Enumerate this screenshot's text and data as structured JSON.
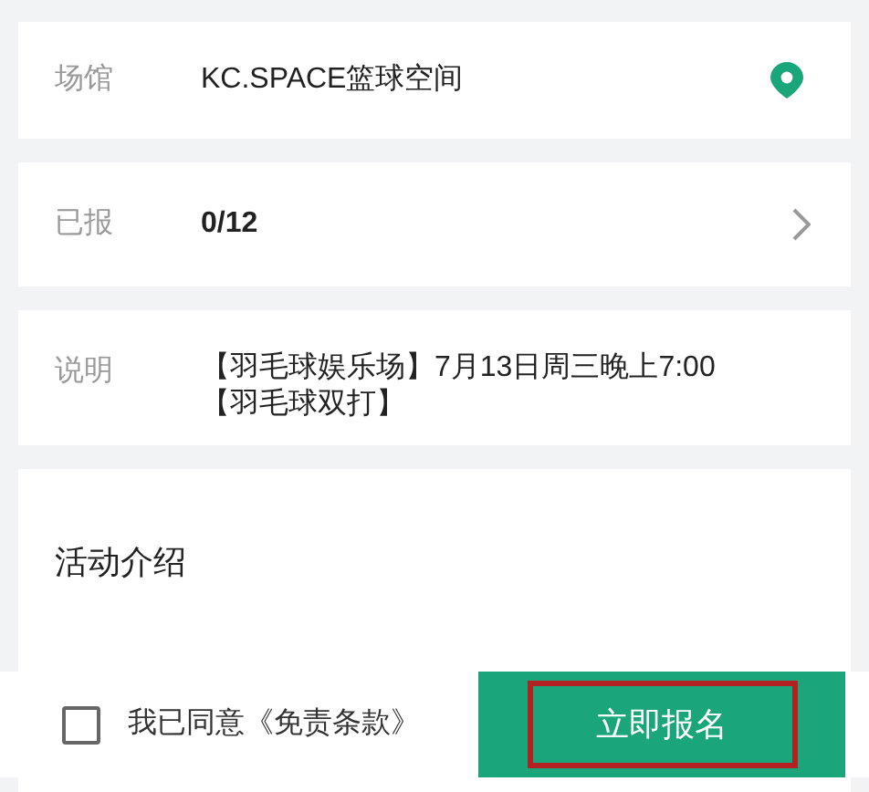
{
  "venue": {
    "label": "场馆",
    "value": "KC.SPACE篮球空间"
  },
  "signed_up": {
    "label": "已报",
    "value": "0/12"
  },
  "note": {
    "label": "说明",
    "lines": [
      "【羽毛球娱乐场】7月13日周三晚上7:00",
      "【羽毛球双打】"
    ]
  },
  "intro": {
    "title": "活动介绍"
  },
  "footer": {
    "agree": {
      "label": "我已同意《免责条款》",
      "checked": false
    },
    "button": {
      "label": "立即报名",
      "outlined": true
    }
  }
}
